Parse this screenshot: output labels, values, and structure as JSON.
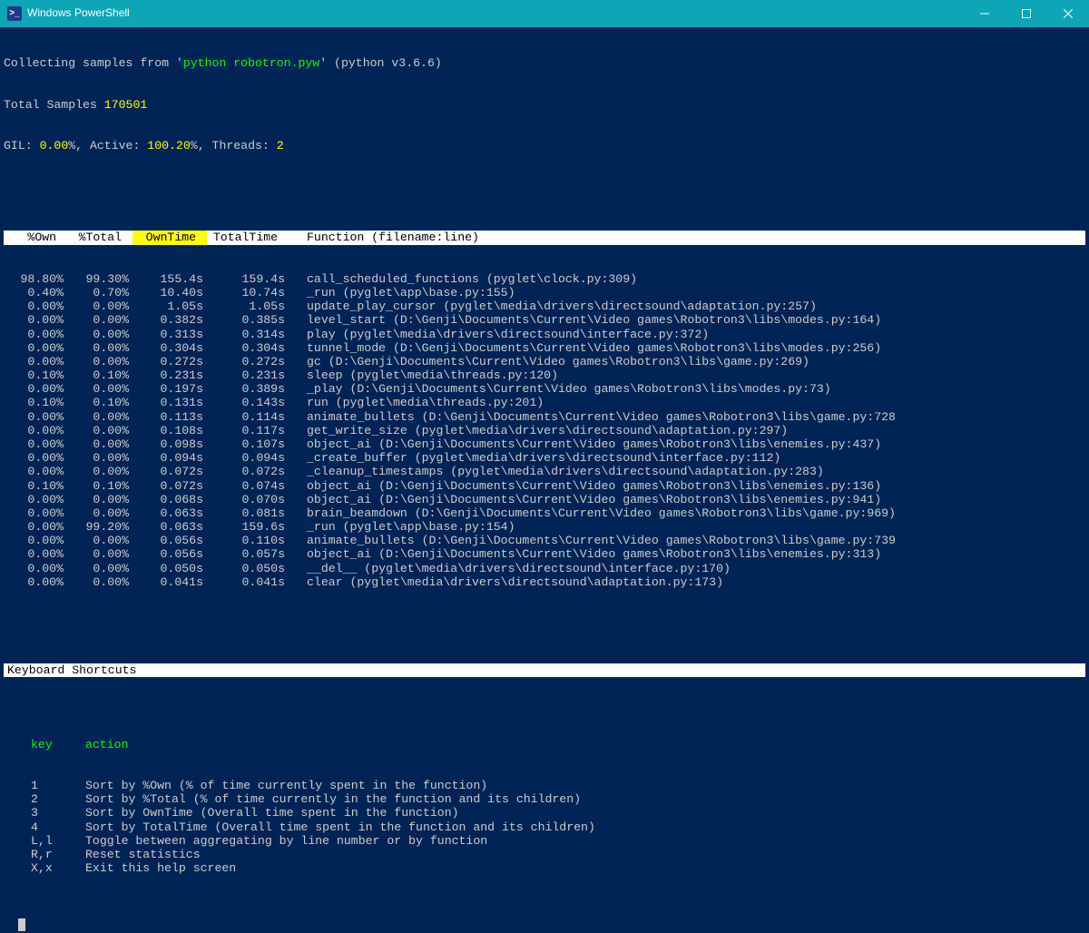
{
  "window": {
    "title": "Windows PowerShell"
  },
  "header": {
    "collecting_prefix": "Collecting samples from '",
    "command": "python robotron.pyw",
    "collecting_suffix": "' (python v3.6.6)",
    "total_samples_label": "Total Samples ",
    "total_samples": "170501",
    "gil_label": "GIL: ",
    "gil_value": "0.00",
    "pct": "%",
    "sep": ", ",
    "active_label": "Active: ",
    "active_value": "100.20",
    "threads_label": "Threads: ",
    "threads_value": "2"
  },
  "columns": {
    "own": "%Own ",
    "total": "%Total ",
    "owntime": " OwnTime ",
    "totaltime": "TotalTime ",
    "func": "Function (filename:line)"
  },
  "rows": [
    {
      "own": "98.80%",
      "total": "99.30%",
      "owntime": "155.4s",
      "totaltime": "159.4s",
      "func": "call_scheduled_functions (pyglet\\clock.py:309)"
    },
    {
      "own": "0.40%",
      "total": "0.70%",
      "owntime": "10.40s",
      "totaltime": "10.74s",
      "func": "_run (pyglet\\app\\base.py:155)"
    },
    {
      "own": "0.00%",
      "total": "0.00%",
      "owntime": "1.05s",
      "totaltime": "1.05s",
      "func": "update_play_cursor (pyglet\\media\\drivers\\directsound\\adaptation.py:257)"
    },
    {
      "own": "0.00%",
      "total": "0.00%",
      "owntime": "0.382s",
      "totaltime": "0.385s",
      "func": "level_start (D:\\Genji\\Documents\\Current\\Video games\\Robotron3\\libs\\modes.py:164)"
    },
    {
      "own": "0.00%",
      "total": "0.00%",
      "owntime": "0.313s",
      "totaltime": "0.314s",
      "func": "play (pyglet\\media\\drivers\\directsound\\interface.py:372)"
    },
    {
      "own": "0.00%",
      "total": "0.00%",
      "owntime": "0.304s",
      "totaltime": "0.304s",
      "func": "tunnel_mode (D:\\Genji\\Documents\\Current\\Video games\\Robotron3\\libs\\modes.py:256)"
    },
    {
      "own": "0.00%",
      "total": "0.00%",
      "owntime": "0.272s",
      "totaltime": "0.272s",
      "func": "gc (D:\\Genji\\Documents\\Current\\Video games\\Robotron3\\libs\\game.py:269)"
    },
    {
      "own": "0.10%",
      "total": "0.10%",
      "owntime": "0.231s",
      "totaltime": "0.231s",
      "func": "sleep (pyglet\\media\\threads.py:120)"
    },
    {
      "own": "0.00%",
      "total": "0.00%",
      "owntime": "0.197s",
      "totaltime": "0.389s",
      "func": "_play (D:\\Genji\\Documents\\Current\\Video games\\Robotron3\\libs\\modes.py:73)"
    },
    {
      "own": "0.10%",
      "total": "0.10%",
      "owntime": "0.131s",
      "totaltime": "0.143s",
      "func": "run (pyglet\\media\\threads.py:201)"
    },
    {
      "own": "0.00%",
      "total": "0.00%",
      "owntime": "0.113s",
      "totaltime": "0.114s",
      "func": "animate_bullets (D:\\Genji\\Documents\\Current\\Video games\\Robotron3\\libs\\game.py:728"
    },
    {
      "own": "0.00%",
      "total": "0.00%",
      "owntime": "0.108s",
      "totaltime": "0.117s",
      "func": "get_write_size (pyglet\\media\\drivers\\directsound\\adaptation.py:297)"
    },
    {
      "own": "0.00%",
      "total": "0.00%",
      "owntime": "0.098s",
      "totaltime": "0.107s",
      "func": "object_ai (D:\\Genji\\Documents\\Current\\Video games\\Robotron3\\libs\\enemies.py:437)"
    },
    {
      "own": "0.00%",
      "total": "0.00%",
      "owntime": "0.094s",
      "totaltime": "0.094s",
      "func": "_create_buffer (pyglet\\media\\drivers\\directsound\\interface.py:112)"
    },
    {
      "own": "0.00%",
      "total": "0.00%",
      "owntime": "0.072s",
      "totaltime": "0.072s",
      "func": "_cleanup_timestamps (pyglet\\media\\drivers\\directsound\\adaptation.py:283)"
    },
    {
      "own": "0.10%",
      "total": "0.10%",
      "owntime": "0.072s",
      "totaltime": "0.074s",
      "func": "object_ai (D:\\Genji\\Documents\\Current\\Video games\\Robotron3\\libs\\enemies.py:136)"
    },
    {
      "own": "0.00%",
      "total": "0.00%",
      "owntime": "0.068s",
      "totaltime": "0.070s",
      "func": "object_ai (D:\\Genji\\Documents\\Current\\Video games\\Robotron3\\libs\\enemies.py:941)"
    },
    {
      "own": "0.00%",
      "total": "0.00%",
      "owntime": "0.063s",
      "totaltime": "0.081s",
      "func": "brain_beamdown (D:\\Genji\\Documents\\Current\\Video games\\Robotron3\\libs\\game.py:969)"
    },
    {
      "own": "0.00%",
      "total": "99.20%",
      "owntime": "0.063s",
      "totaltime": "159.6s",
      "func": "_run (pyglet\\app\\base.py:154)"
    },
    {
      "own": "0.00%",
      "total": "0.00%",
      "owntime": "0.056s",
      "totaltime": "0.110s",
      "func": "animate_bullets (D:\\Genji\\Documents\\Current\\Video games\\Robotron3\\libs\\game.py:739"
    },
    {
      "own": "0.00%",
      "total": "0.00%",
      "owntime": "0.056s",
      "totaltime": "0.057s",
      "func": "object_ai (D:\\Genji\\Documents\\Current\\Video games\\Robotron3\\libs\\enemies.py:313)"
    },
    {
      "own": "0.00%",
      "total": "0.00%",
      "owntime": "0.050s",
      "totaltime": "0.050s",
      "func": "__del__ (pyglet\\media\\drivers\\directsound\\interface.py:170)"
    },
    {
      "own": "0.00%",
      "total": "0.00%",
      "owntime": "0.041s",
      "totaltime": "0.041s",
      "func": "clear (pyglet\\media\\drivers\\directsound\\adaptation.py:173)"
    }
  ],
  "shortcuts_header": "Keyboard Shortcuts",
  "shortcuts_cols": {
    "key": "key",
    "action": "action"
  },
  "shortcuts": [
    {
      "key": "1",
      "action": "Sort by %Own (% of time currently spent in the function)"
    },
    {
      "key": "2",
      "action": "Sort by %Total (% of time currently in the function and its children)"
    },
    {
      "key": "3",
      "action": "Sort by OwnTime (Overall time spent in the function)"
    },
    {
      "key": "4",
      "action": "Sort by TotalTime (Overall time spent in the function and its children)"
    },
    {
      "key": "L,l",
      "action": "Toggle between aggregating by line number or by function"
    },
    {
      "key": "R,r",
      "action": "Reset statistics"
    },
    {
      "key": "X,x",
      "action": "Exit this help screen"
    }
  ]
}
